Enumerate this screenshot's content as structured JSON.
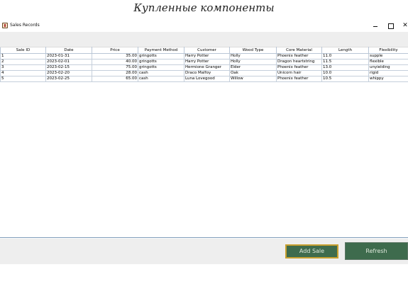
{
  "page": {
    "heading": "Купленные компоненты"
  },
  "window": {
    "title": "Sales Records",
    "controls": {
      "minimize_icon": "minimize-icon",
      "maximize_icon": "maximize-icon",
      "close_glyph": "✕"
    }
  },
  "table": {
    "columns": [
      "Sale ID",
      "Date",
      "Price",
      "Payment Method",
      "Customer",
      "Wood Type",
      "Core Material",
      "Length",
      "Flexibility"
    ],
    "rows": [
      [
        "1",
        "2023-01-31",
        "35.00",
        "gringotts",
        "Harry Potter",
        "Holly",
        "Phoenix feather",
        "11.0",
        "supple"
      ],
      [
        "2",
        "2023-02-01",
        "40.00",
        "gringotts",
        "Harry Potter",
        "Holly",
        "Dragon heartstring",
        "11.5",
        "flexible"
      ],
      [
        "3",
        "2023-02-15",
        "75.00",
        "gringotts",
        "Hermione Granger",
        "Elder",
        "Phoenix feather",
        "13.0",
        "unyielding"
      ],
      [
        "4",
        "2023-02-20",
        "28.00",
        "cash",
        "Draco Malfoy",
        "Oak",
        "Unicorn hair",
        "10.0",
        "rigid"
      ],
      [
        "5",
        "2023-02-25",
        "65.00",
        "cash",
        "Luna Lovegood",
        "Willow",
        "Phoenix feather",
        "10.5",
        "whippy"
      ]
    ]
  },
  "buttons": {
    "add_sale": "Add Sale",
    "refresh": "Refresh"
  },
  "colors": {
    "button_bg": "#3e6b4d",
    "button_text": "#dfe9dc",
    "add_sale_border": "#c8a030",
    "grid_line": "#c5cfdb",
    "panel_bg": "#eeeeee"
  }
}
